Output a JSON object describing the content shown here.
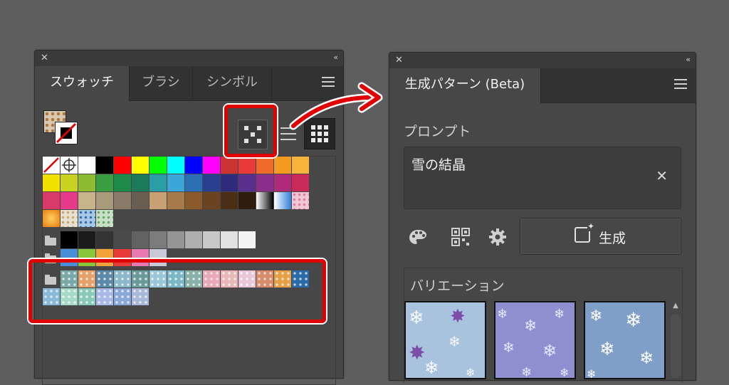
{
  "swatches_panel": {
    "close_glyph": "✕",
    "collapse_glyph": "‹‹",
    "tabs": [
      {
        "label": "スウォッチ",
        "active": true
      },
      {
        "label": "ブラシ",
        "active": false
      },
      {
        "label": "シンボル",
        "active": false
      }
    ],
    "icons": [
      "close-icon",
      "collapse-icon",
      "panel-menu-icon",
      "pattern-options-icon",
      "list-view-icon",
      "grid-view-icon",
      "folder-icon"
    ],
    "rows": [
      [
        "none",
        "registration",
        "#ffffff",
        "#000000",
        "#ff0000",
        "#ffff00",
        "#00ff00",
        "#00ffff",
        "#0000ff",
        "#ff00ff",
        "#cc3333",
        "#e83a3a",
        "#ee6b2a",
        "#f49a1e",
        "#f6b43d"
      ],
      [
        "#f2e100",
        "#c9d31f",
        "#8dbb31",
        "#3a9d3f",
        "#1d8a4a",
        "#1b7a5a",
        "#2a9da5",
        "#3aa7d8",
        "#2d6fb5",
        "#2b3f8f",
        "#2f2b7a",
        "#5a2e8c",
        "#8a2e8c",
        "#b02a7a",
        "#c92a5a"
      ],
      [
        "#d93a6a",
        "#e83a8a",
        "#c8b48a",
        "#a89a7a",
        "#8a7a6a",
        "#6a5e52",
        "#c8a074",
        "#a87a4a",
        "#8a5a2a",
        "#6a4420",
        "#4a2e16",
        "#2e1c0e",
        "gradient-bw",
        "gradient-blue",
        "pattern-pink"
      ],
      [
        "gradient-orange",
        "pattern-check",
        "pattern-blue",
        "pattern-green"
      ],
      [
        "folder",
        "#000000",
        "#1b1b1b",
        "#333333",
        "#4a4a4a",
        "#626262",
        "#7c7c7c",
        "#959595",
        "#afafaf",
        "#c8c8c8",
        "#e1e1e1",
        "#f4f4f4"
      ],
      [
        "folder",
        "#4a8ed8",
        "#8ac63c",
        "#f2a23a",
        "#e83a3a",
        "#e87ab2",
        "#c8c8d8"
      ],
      [
        "folder",
        "#7aa8a4",
        "#e8a06a",
        "#5a8aa8",
        "#8ab8c8",
        "#6a9a9a",
        "#9ac8d8",
        "#7ab8c8",
        "#88b0a8",
        "#e8a8b8",
        "#e8b8b8",
        "#e8c8d8",
        "#d88a6a",
        "#e8a048",
        "#2a6aa8"
      ],
      [
        "#8ab8d8",
        "#a8d8c8",
        "#8ac8b8",
        "#a8b8e8",
        "#8aa8d8",
        "#a8b8d8"
      ]
    ]
  },
  "generate_panel": {
    "close_glyph": "✕",
    "collapse_glyph": "‹‹",
    "tab_label": "生成パターン (Beta)",
    "prompt_label": "プロンプト",
    "prompt_value": "雪の結晶",
    "clear_glyph": "✕",
    "generate_label": "生成",
    "variations_label": "バリエーション",
    "icons": [
      "palette-icon",
      "qr-icon",
      "gear-icon",
      "generate-icon",
      "clear-icon"
    ],
    "thumbnails": [
      "snowflake-pattern-1",
      "snowflake-pattern-2",
      "snowflake-pattern-3"
    ]
  },
  "annotation": {
    "frame_color": "#e00000",
    "arrow_color": "#e00000"
  }
}
